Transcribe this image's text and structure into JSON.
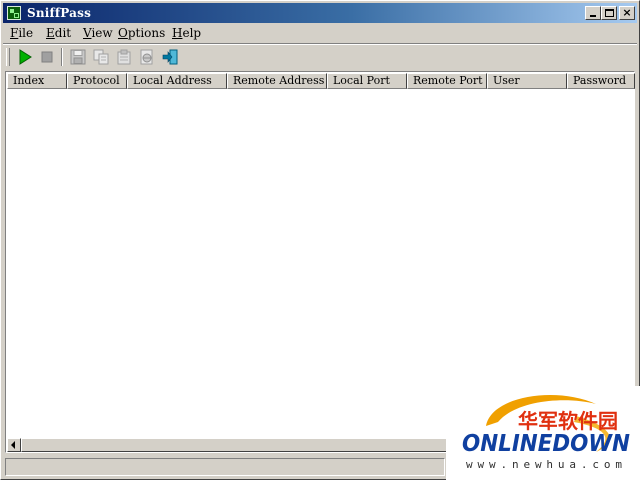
{
  "window": {
    "title": "SniffPass",
    "app_icon": "sniffpass-app-icon",
    "caption_buttons": [
      "minimize",
      "maximize",
      "close"
    ]
  },
  "menu": {
    "items": [
      {
        "label": "File",
        "accel": "F",
        "rest": "ile"
      },
      {
        "label": "Edit",
        "accel": "E",
        "rest": "dit"
      },
      {
        "label": "View",
        "accel": "V",
        "rest": "iew"
      },
      {
        "label": "Options",
        "accel": "O",
        "rest": "ptions"
      },
      {
        "label": "Help",
        "accel": "H",
        "rest": "elp"
      }
    ]
  },
  "toolbar": {
    "buttons": [
      {
        "icon": "start-capture-icon",
        "enabled": true
      },
      {
        "icon": "stop-capture-icon",
        "enabled": false
      },
      {
        "icon": "save-icon",
        "enabled": false
      },
      {
        "icon": "copy-icon",
        "enabled": false
      },
      {
        "icon": "properties-icon",
        "enabled": false
      },
      {
        "icon": "html-report-icon",
        "enabled": false
      },
      {
        "icon": "exit-icon",
        "enabled": true
      }
    ],
    "colors": {
      "start": "#00b000",
      "exit": "#0078a0",
      "disabled": "#a0a0a0"
    }
  },
  "list": {
    "columns": [
      "Index",
      "Protocol",
      "Local Address",
      "Remote Address",
      "Local Port",
      "Remote Port",
      "User",
      "Password"
    ],
    "rows": []
  },
  "statusbar": {
    "text": ""
  },
  "watermark": {
    "chinese": "华军软件园",
    "brand": "ONLINEDOWN",
    "url": "www.newhua.com",
    "colors": {
      "chinese": "#e03010",
      "brand": "#1040a0",
      "swoosh": "#f0a000",
      "url": "#303030"
    }
  },
  "colors": {
    "titlebar_start": "#0a246a",
    "titlebar_end": "#a6caf0",
    "face": "#d4d0c8"
  }
}
